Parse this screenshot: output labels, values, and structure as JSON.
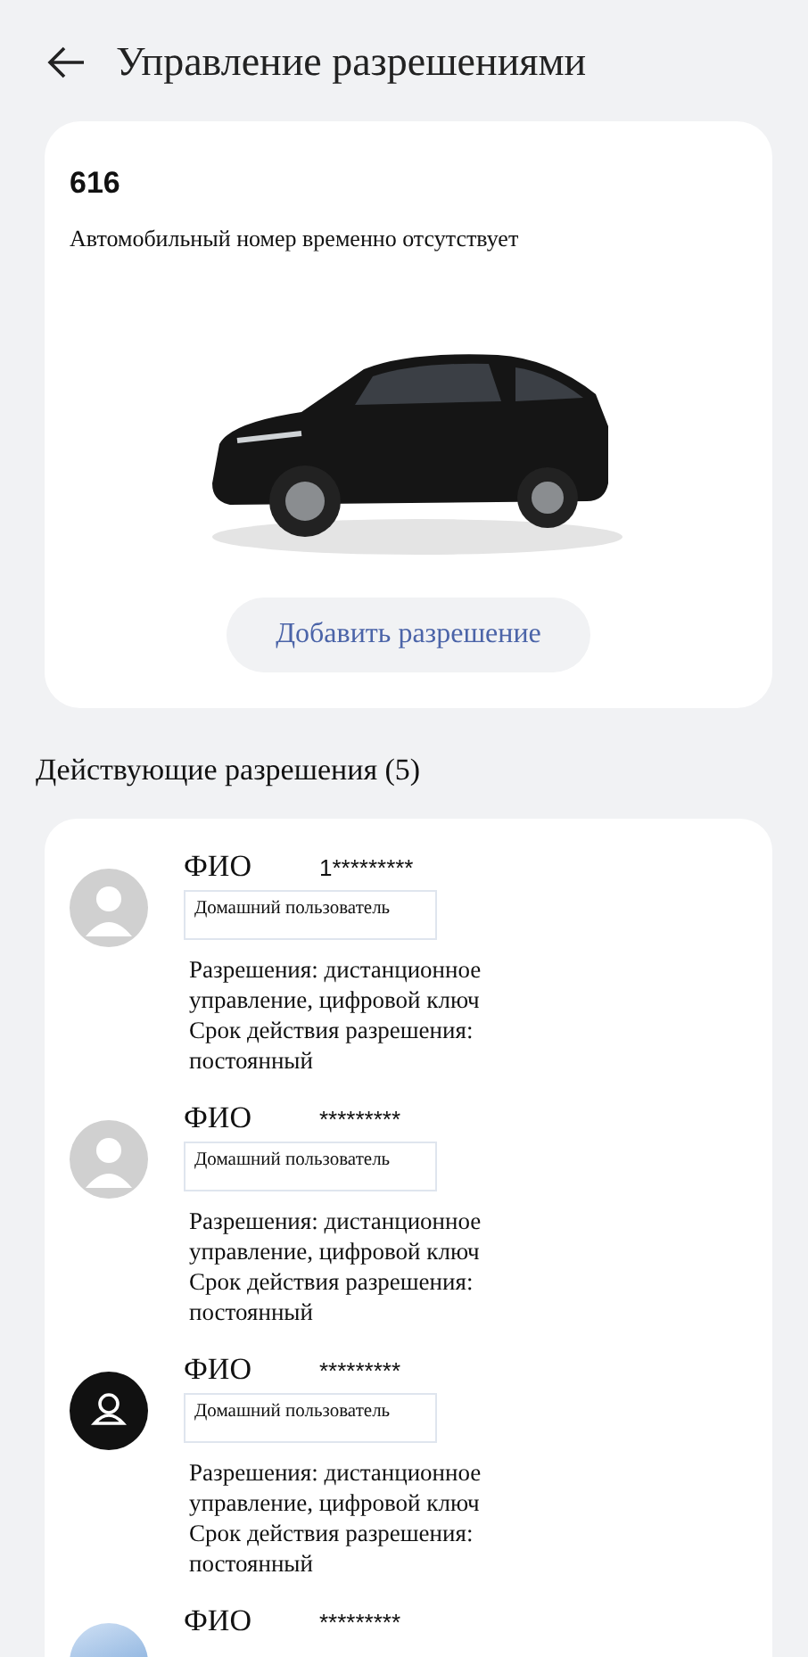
{
  "header": {
    "title": "Управление разрешениями"
  },
  "vehicle": {
    "name": "616",
    "plate_status": "Автомобильный номер временно отсутствует",
    "add_button": "Добавить разрешение"
  },
  "section_title": "Действующие разрешения (5)",
  "users": [
    {
      "kind": "default",
      "name": "ФИО",
      "phone": "1*********",
      "role": "Домашний пользователь",
      "permissions": "Разрешения: дистанционное управление, цифровой ключ",
      "validity": "Срок действия разрешения: постоянный"
    },
    {
      "kind": "default",
      "name": "ФИО",
      "phone": "*********",
      "role": "Домашний пользователь",
      "permissions": "Разрешения: дистанционное управление, цифровой ключ",
      "validity": "Срок действия разрешения: постоянный"
    },
    {
      "kind": "dark",
      "name": "ФИО",
      "phone": "*********",
      "role": "Домашний пользователь",
      "permissions": "Разрешения: дистанционное управление, цифровой ключ",
      "validity": "Срок действия разрешения: постоянный"
    },
    {
      "kind": "photo",
      "name": "ФИО",
      "phone": "*********"
    }
  ]
}
